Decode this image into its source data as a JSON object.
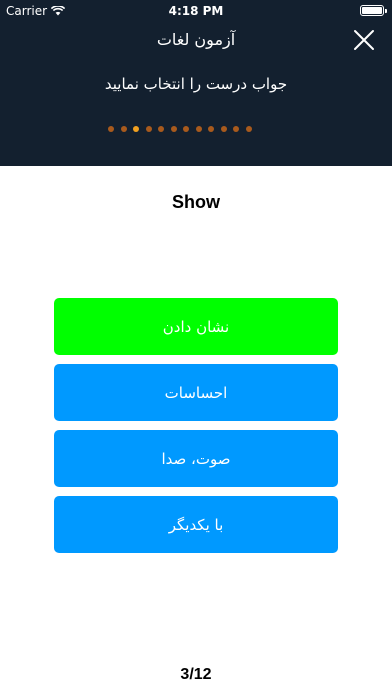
{
  "status_bar": {
    "carrier": "Carrier",
    "time": "4:18 PM",
    "wifi_icon": "wifi-icon",
    "battery_icon": "battery-icon"
  },
  "header": {
    "title": "آزمون لغات",
    "instruction": "جواب درست را انتخاب نمایید",
    "close_icon": "close-icon",
    "background_color": "#13202f",
    "progress": {
      "total": 12,
      "current": 3,
      "active_color": "#f0a020",
      "inactive_color": "#a85a1d"
    }
  },
  "question": {
    "word": "Show"
  },
  "options": [
    {
      "label": "نشان دادن",
      "color": "#00ff00"
    },
    {
      "label": "احساسات",
      "color": "#0099ff"
    },
    {
      "label": "صوت، صدا",
      "color": "#0099ff"
    },
    {
      "label": "با یکدیگر",
      "color": "#0099ff"
    }
  ],
  "footer": {
    "counter": "3/12"
  }
}
